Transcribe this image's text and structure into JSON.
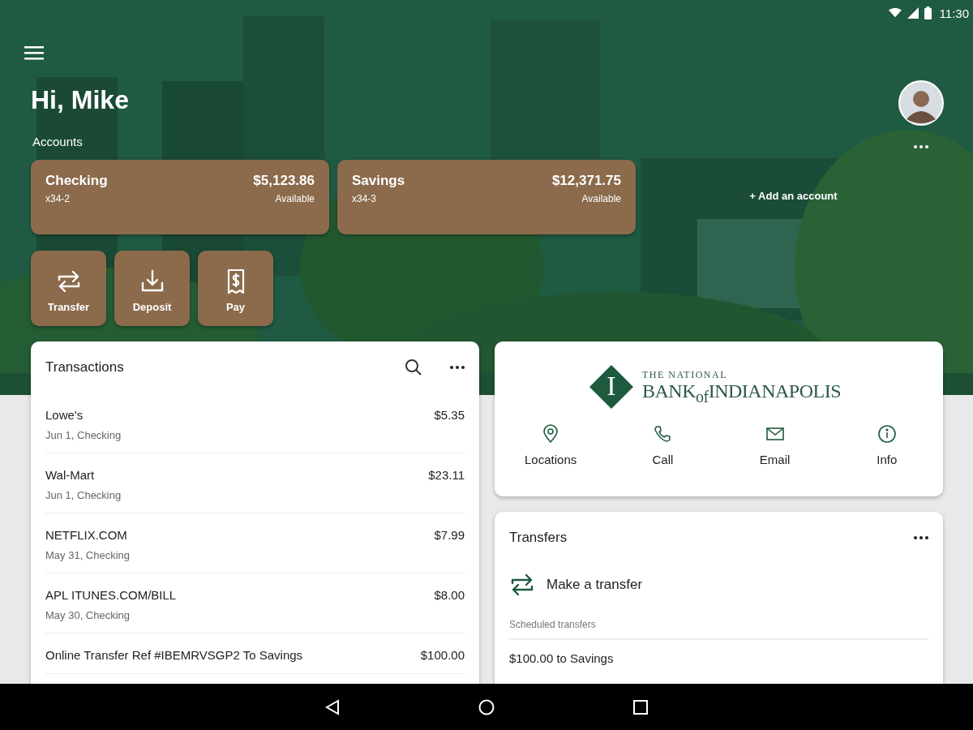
{
  "status_bar": {
    "time": "11:30"
  },
  "greeting": "Hi, Mike",
  "accounts_label": "Accounts",
  "accounts": [
    {
      "name": "Checking",
      "number": "x34-2",
      "balance": "$5,123.86",
      "balance_label": "Available"
    },
    {
      "name": "Savings",
      "number": "x34-3",
      "balance": "$12,371.75",
      "balance_label": "Available"
    }
  ],
  "add_account": "+ Add an account",
  "quick_actions": [
    {
      "label": "Transfer",
      "kind": "transfer"
    },
    {
      "label": "Deposit",
      "kind": "deposit"
    },
    {
      "label": "Pay",
      "kind": "pay"
    }
  ],
  "transactions": {
    "title": "Transactions",
    "rows": [
      {
        "merchant": "Lowe's",
        "detail": "Jun 1, Checking",
        "amount": "$5.35"
      },
      {
        "merchant": "Wal-Mart",
        "detail": "Jun 1, Checking",
        "amount": "$23.11"
      },
      {
        "merchant": "NETFLIX.COM",
        "detail": "May 31, Checking",
        "amount": "$7.99"
      },
      {
        "merchant": "APL ITUNES.COM/BILL",
        "detail": "May 30, Checking",
        "amount": "$8.00"
      },
      {
        "merchant": "Online Transfer Ref #IBEMRVSGP2 To Savings",
        "amount": "$100.00"
      }
    ]
  },
  "bank": {
    "logo": {
      "mark": "I",
      "top_line": "THE NATIONAL",
      "name": "BANK$_{of}$INDIANAPOLIS"
    },
    "contacts": [
      {
        "label": "Locations",
        "kind": "locations"
      },
      {
        "label": "Call",
        "kind": "call"
      },
      {
        "label": "Email",
        "kind": "email"
      },
      {
        "label": "Info",
        "kind": "info"
      }
    ]
  },
  "transfers": {
    "title": "Transfers",
    "action": "Make a transfer",
    "scheduled_label": "Scheduled transfers",
    "scheduled": [
      "$100.00 to Savings"
    ]
  }
}
